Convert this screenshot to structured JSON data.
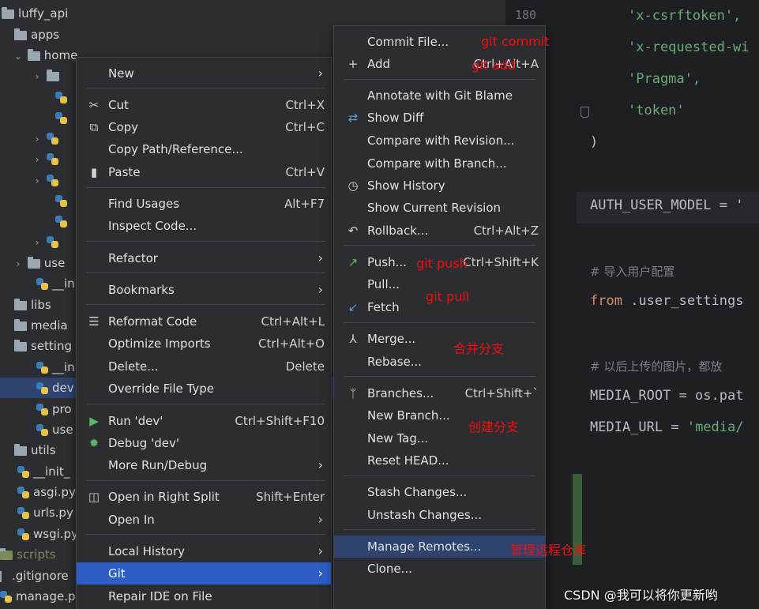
{
  "project_tree": {
    "rows": [
      {
        "label": "luffy_api",
        "type": "folder"
      },
      {
        "label": "apps",
        "type": "folder"
      },
      {
        "label": "home",
        "type": "folder",
        "expanded": true
      },
      {
        "label": "",
        "type": "folder",
        "collapsed": true
      },
      {
        "label": "",
        "type": "py"
      },
      {
        "label": "",
        "type": "py"
      },
      {
        "label": "",
        "type": "py",
        "collapsed": true
      },
      {
        "label": "",
        "type": "py",
        "collapsed": true
      },
      {
        "label": "",
        "type": "py",
        "collapsed": true
      },
      {
        "label": "",
        "type": "py"
      },
      {
        "label": "",
        "type": "py"
      },
      {
        "label": "",
        "type": "py",
        "collapsed": true
      },
      {
        "label": "use",
        "type": "folder",
        "collapsed": true
      },
      {
        "label": "__in",
        "type": "py"
      },
      {
        "label": "libs",
        "type": "folder"
      },
      {
        "label": "media",
        "type": "folder"
      },
      {
        "label": "setting",
        "type": "folder"
      },
      {
        "label": "__in",
        "type": "py"
      },
      {
        "label": "dev",
        "type": "py",
        "selected": true
      },
      {
        "label": "pro",
        "type": "py"
      },
      {
        "label": "use",
        "type": "py"
      },
      {
        "label": "utils",
        "type": "folder"
      },
      {
        "label": "__init_",
        "type": "py"
      },
      {
        "label": "asgi.py",
        "type": "py"
      },
      {
        "label": "urls.py",
        "type": "py"
      },
      {
        "label": "wsgi.py",
        "type": "py"
      },
      {
        "label": "scripts",
        "type": "folder"
      },
      {
        "label": ".gitignore",
        "type": "file"
      },
      {
        "label": "manage.p",
        "type": "py"
      }
    ]
  },
  "editor": {
    "line_number": "180",
    "lines": [
      {
        "text": "'x-csrftoken',",
        "kind": "str"
      },
      {
        "text": "'x-requested-wi",
        "kind": "str"
      },
      {
        "text": "'Pragma',",
        "kind": "str"
      },
      {
        "text": "'token'",
        "kind": "str"
      },
      {
        "text": ")",
        "kind": "plain"
      },
      {
        "text": "AUTH_USER_MODEL = '",
        "kind": "plain"
      },
      {
        "text": "# 导入用户配置",
        "kind": "cmt"
      },
      {
        "text": "from .user_settings",
        "kind": "from"
      },
      {
        "text": "# 以后上传的图片，都放",
        "kind": "cmt"
      },
      {
        "text": "MEDIA_ROOT = os.pat",
        "kind": "plain"
      },
      {
        "text": "MEDIA_URL = 'media/",
        "kind": "media_url"
      }
    ]
  },
  "context_menu": {
    "items": [
      {
        "label": "New",
        "arrow": true
      },
      {
        "label": "Cut",
        "shortcut": "Ctrl+X",
        "icon": "scissors-icon"
      },
      {
        "label": "Copy",
        "shortcut": "Ctrl+C",
        "icon": "copy-icon"
      },
      {
        "label": "Copy Path/Reference..."
      },
      {
        "label": "Paste",
        "shortcut": "Ctrl+V",
        "icon": "paste-icon"
      },
      {
        "label": "Find Usages",
        "shortcut": "Alt+F7"
      },
      {
        "label": "Inspect Code..."
      },
      {
        "label": "Refactor",
        "arrow": true
      },
      {
        "label": "Bookmarks",
        "arrow": true
      },
      {
        "label": "Reformat Code",
        "shortcut": "Ctrl+Alt+L",
        "icon": "reformat-icon"
      },
      {
        "label": "Optimize Imports",
        "shortcut": "Ctrl+Alt+O"
      },
      {
        "label": "Delete...",
        "shortcut": "Delete"
      },
      {
        "label": "Override File Type"
      },
      {
        "label": "Run 'dev'",
        "shortcut": "Ctrl+Shift+F10",
        "icon": "run-icon"
      },
      {
        "label": "Debug 'dev'",
        "icon": "debug-icon"
      },
      {
        "label": "More Run/Debug",
        "arrow": true
      },
      {
        "label": "Open in Right Split",
        "shortcut": "Shift+Enter",
        "icon": "split-icon"
      },
      {
        "label": "Open In",
        "arrow": true
      },
      {
        "label": "Local History",
        "arrow": true
      },
      {
        "label": "Git",
        "arrow": true,
        "highlighted": true
      },
      {
        "label": "Repair IDE on File"
      }
    ]
  },
  "git_submenu": {
    "items": [
      {
        "label": "Commit File..."
      },
      {
        "label": "Add",
        "shortcut": "Ctrl+Alt+A",
        "icon": "plus-icon"
      },
      {
        "label": "Annotate with Git Blame"
      },
      {
        "label": "Show Diff",
        "icon": "diff-icon"
      },
      {
        "label": "Compare with Revision..."
      },
      {
        "label": "Compare with Branch..."
      },
      {
        "label": "Show History",
        "icon": "clock-icon"
      },
      {
        "label": "Show Current Revision"
      },
      {
        "label": "Rollback...",
        "shortcut": "Ctrl+Alt+Z",
        "icon": "rollback-icon"
      },
      {
        "label": "Push...",
        "shortcut": "Ctrl+Shift+K",
        "icon": "push-icon"
      },
      {
        "label": "Pull..."
      },
      {
        "label": "Fetch",
        "icon": "fetch-icon"
      },
      {
        "label": "Merge...",
        "icon": "merge-icon"
      },
      {
        "label": "Rebase..."
      },
      {
        "label": "Branches...",
        "shortcut": "Ctrl+Shift+`",
        "icon": "branch-icon"
      },
      {
        "label": "New Branch..."
      },
      {
        "label": "New Tag..."
      },
      {
        "label": "Reset HEAD..."
      },
      {
        "label": "Stash Changes..."
      },
      {
        "label": "Unstash Changes..."
      },
      {
        "label": "Manage Remotes...",
        "highlighted": true
      },
      {
        "label": "Clone..."
      }
    ]
  },
  "annotations": {
    "commit": "git commit",
    "add": "git add",
    "push": "git push",
    "pull": "git pull",
    "merge": "合并分支",
    "branch": "创建分支",
    "remotes": "管理远程仓库"
  },
  "watermark": "CSDN @我可以将你更新哟",
  "colors": {
    "highlight": "#2e5ec4",
    "annotation": "#f20d0d",
    "menu_bg": "#2b2d30"
  }
}
